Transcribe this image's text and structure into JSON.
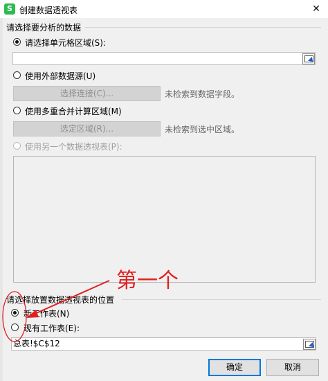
{
  "window": {
    "title": "创建数据透视表",
    "app_icon_letter": "S",
    "close_glyph": "✕"
  },
  "section_source": {
    "title": "请选择要分析的数据",
    "option_cells": "请选择单元格区域(S):",
    "cells_value": "",
    "option_external": "使用外部数据源(U)",
    "choose_connection": "选择连接(C)...",
    "external_note": "未检索到数据字段。",
    "option_multi": "使用多重合并计算区域(M)",
    "choose_ranges": "选定区域(R)...",
    "multi_note": "未检索到选中区域。",
    "option_other_pivot": "使用另一个数据透视表(P):"
  },
  "section_target": {
    "title": "请选择放置数据透视表的位置",
    "option_new": "新工作表(N)",
    "option_existing": "现有工作表(E):",
    "location_value": "总表!$C$12"
  },
  "buttons": {
    "ok": "确定",
    "cancel": "取消"
  },
  "annotation": {
    "text": "第一个",
    "color": "#e21f1f"
  },
  "selected": {
    "source": "cells",
    "target": "new"
  }
}
